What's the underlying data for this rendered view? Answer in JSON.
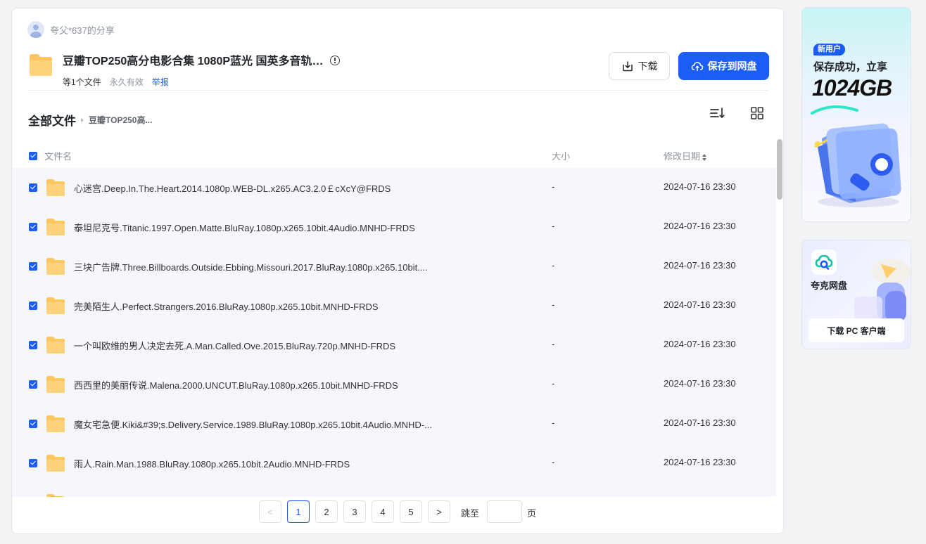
{
  "sharer": {
    "name": "夸父*637的分享"
  },
  "share": {
    "title": "豆瓣TOP250高分电影合集 1080P蓝光 国英多音轨…",
    "count": "等1个文件",
    "validity": "永久有效",
    "report": "举报",
    "download_label": "下载",
    "save_label": "保存到网盘"
  },
  "breadcrumb": {
    "root": "全部文件",
    "current": "豆瓣TOP250高..."
  },
  "table": {
    "col_name": "文件名",
    "col_size": "大小",
    "col_date": "修改日期",
    "rows": [
      {
        "name": "心迷宫.Deep.In.The.Heart.2014.1080p.WEB-DL.x265.AC3.2.0￡cXcY@FRDS",
        "size": "-",
        "date": "2024-07-16 23:30"
      },
      {
        "name": "泰坦尼克号.Titanic.1997.Open.Matte.BluRay.1080p.x265.10bit.4Audio.MNHD-FRDS",
        "size": "-",
        "date": "2024-07-16 23:30"
      },
      {
        "name": "三块广告牌.Three.Billboards.Outside.Ebbing.Missouri.2017.BluRay.1080p.x265.10bit....",
        "size": "-",
        "date": "2024-07-16 23:30"
      },
      {
        "name": "完美陌生人.Perfect.Strangers.2016.BluRay.1080p.x265.10bit.MNHD-FRDS",
        "size": "-",
        "date": "2024-07-16 23:30"
      },
      {
        "name": "一个叫欧维的男人决定去死.A.Man.Called.Ove.2015.BluRay.720p.MNHD-FRDS",
        "size": "-",
        "date": "2024-07-16 23:30"
      },
      {
        "name": "西西里的美丽传说.Malena.2000.UNCUT.BluRay.1080p.x265.10bit.MNHD-FRDS",
        "size": "-",
        "date": "2024-07-16 23:30"
      },
      {
        "name": "魔女宅急便.Kiki&#39;s.Delivery.Service.1989.BluRay.1080p.x265.10bit.4Audio.MNHD-...",
        "size": "-",
        "date": "2024-07-16 23:30"
      },
      {
        "name": "雨人.Rain.Man.1988.BluRay.1080p.x265.10bit.2Audio.MNHD-FRDS",
        "size": "-",
        "date": "2024-07-16 23:30"
      }
    ]
  },
  "pagination": {
    "prev": "<",
    "pages": [
      "1",
      "2",
      "3",
      "4",
      "5"
    ],
    "current_page": "1",
    "next": ">",
    "jump_label": "跳至",
    "page_suffix": "页",
    "jump_value": ""
  },
  "promo": {
    "badge": "新用户",
    "line1": "保存成功，立享",
    "line2": "1024GB"
  },
  "client": {
    "app_name": "夸克网盘",
    "button_label": "下载 PC 客户端"
  },
  "colors": {
    "accent": "#1a5ef6",
    "folder": "#ffc65d",
    "page_bg": "#f2f3f5",
    "list_bg": "#f6f7fc"
  },
  "icons": {
    "folder": "folder-icon",
    "info": "info-icon",
    "download": "download-icon",
    "cloud_upload": "cloud-upload-icon",
    "sort": "sort-icon",
    "grid": "grid-view-icon"
  }
}
